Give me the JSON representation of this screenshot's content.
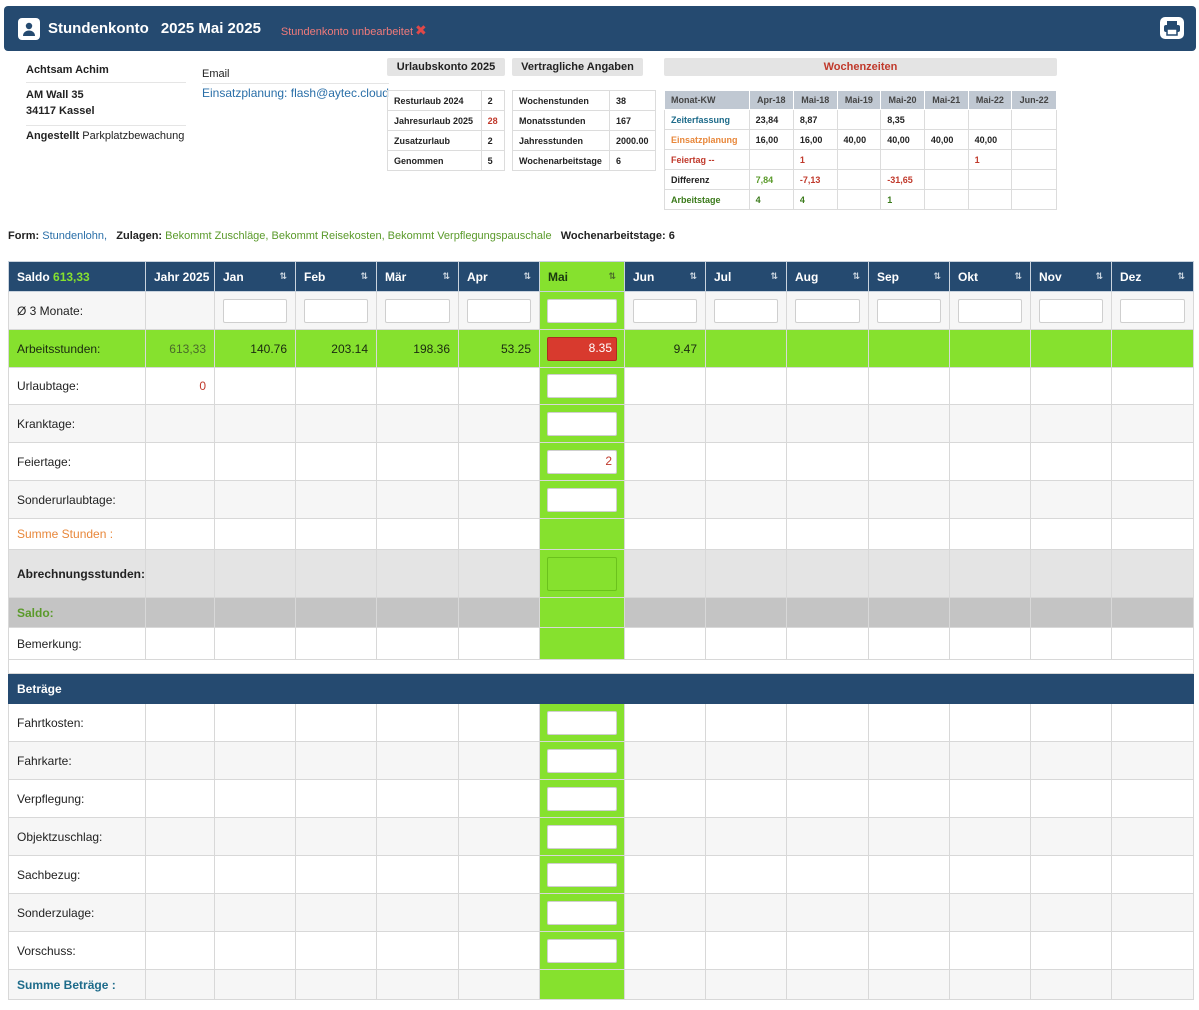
{
  "header": {
    "title": "Stundenkonto",
    "period": "2025 Mai 2025",
    "status": "Stundenkonto unbearbeitet",
    "status_mark": "✖"
  },
  "person": {
    "name": "Achtsam Achim",
    "street": "AM Wall 35",
    "city": "34117 Kassel",
    "employment_label": "Angestellt",
    "employment_value": "Parkplatzbewachung"
  },
  "contact": {
    "email_label": "Email",
    "email_value": "Einsatzplanung: flash@aytec.cloud"
  },
  "urlaubskonto": {
    "title": "Urlaubskonto 2025",
    "rows": [
      {
        "label": "Resturlaub 2024",
        "value": "2"
      },
      {
        "label": "Jahresurlaub 2025",
        "value": "28"
      },
      {
        "label": "Zusatzurlaub",
        "value": "2"
      },
      {
        "label": "Genommen",
        "value": "5"
      }
    ]
  },
  "vertraglich": {
    "title": "Vertragliche Angaben",
    "rows": [
      {
        "label": "Wochenstunden",
        "value": "38"
      },
      {
        "label": "Monatsstunden",
        "value": "167"
      },
      {
        "label": "Jahresstunden",
        "value": "2000.00"
      },
      {
        "label": "Wochenarbeitstage",
        "value": "6"
      }
    ]
  },
  "wochenzeiten": {
    "title": "Wochenzeiten",
    "columns": [
      "Monat-KW",
      "Apr-18",
      "Mai-18",
      "Mai-19",
      "Mai-20",
      "Mai-21",
      "Mai-22",
      "Jun-22"
    ],
    "rows": [
      {
        "label": "Zeiterfassung",
        "values": [
          "23,84",
          "8,87",
          "",
          "8,35",
          "",
          "",
          ""
        ]
      },
      {
        "label": "Einsatzplanung",
        "values": [
          "16,00",
          "16,00",
          "40,00",
          "40,00",
          "40,00",
          "40,00",
          ""
        ]
      },
      {
        "label": "Feiertag --",
        "values": [
          "",
          "1",
          "",
          "",
          "",
          "1",
          ""
        ]
      },
      {
        "label": "Differenz",
        "values": [
          "7,84",
          "-7,13",
          "",
          "-31,65",
          "",
          "",
          ""
        ]
      },
      {
        "label": "Arbeitstage",
        "values": [
          "4",
          "4",
          "",
          "1",
          "",
          "",
          ""
        ]
      }
    ]
  },
  "formline": {
    "form_label": "Form:",
    "form_value": "Stundenlohn,",
    "zulagen_label": "Zulagen:",
    "zulagen_value": "Bekommt Zuschläge, Bekommt Reisekosten, Bekommt Verpflegungspauschale",
    "tage_label": "Wochenarbeitstage: 6"
  },
  "main": {
    "saldo_label": "Saldo",
    "saldo_value": "613,33",
    "jahr_label": "Jahr 2025",
    "months": [
      "Jan",
      "Feb",
      "Mär",
      "Apr",
      "Mai",
      "Jun",
      "Jul",
      "Aug",
      "Sep",
      "Okt",
      "Nov",
      "Dez"
    ],
    "sort_icon": "⇅",
    "rows": {
      "avg": "Ø 3 Monate:",
      "arbeit": "Arbeitsstunden:",
      "arbeit_jahr": "613,33",
      "arbeit_values": [
        "140.76",
        "203.14",
        "198.36",
        "53.25",
        "8.35",
        "9.47"
      ],
      "urlaub": "Urlaubtage:",
      "urlaub_jahr": "0",
      "krank": "Kranktage:",
      "feier": "Feiertage:",
      "feier_mai": "2",
      "sonder": "Sonderurlaubtage:",
      "summe": "Summe Stunden :",
      "abrechnung": "Abrechnungsstunden:",
      "saldo": "Saldo:",
      "bemerkung": "Bemerkung:"
    },
    "betraege": {
      "title": "Beträge",
      "rows": [
        "Fahrtkosten:",
        "Fahrkarte:",
        "Verpflegung:",
        "Objektzuschlag:",
        "Sachbezug:",
        "Sonderzulage:",
        "Vorschuss:"
      ],
      "summe": "Summe Beträge :"
    }
  }
}
